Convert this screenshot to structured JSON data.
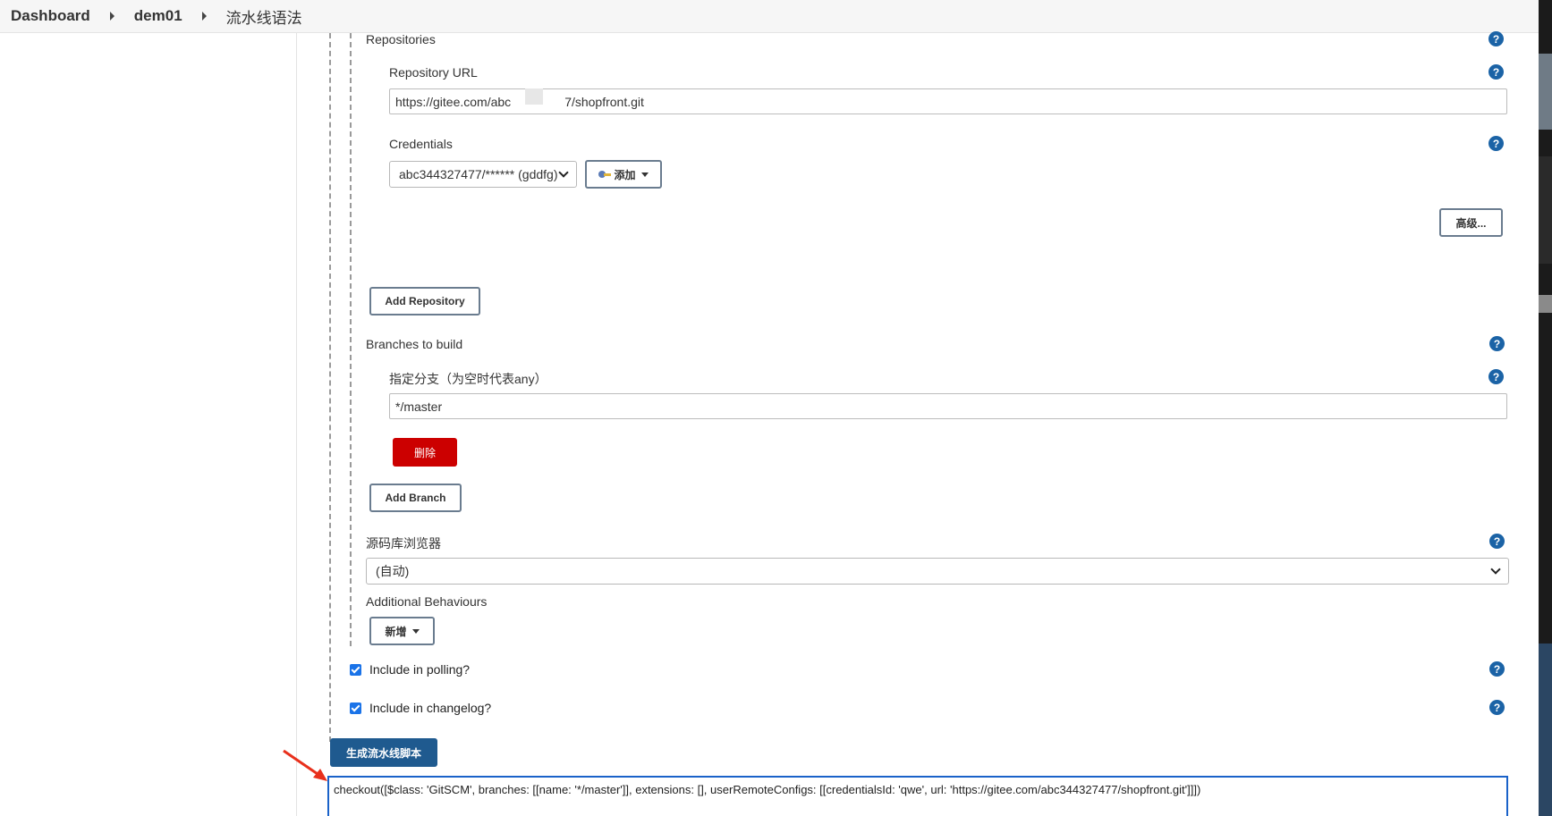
{
  "breadcrumb": {
    "items": [
      "Dashboard",
      "dem01"
    ],
    "current": "流水线语法"
  },
  "form": {
    "repositories_label": "Repositories",
    "repo_url_label": "Repository URL",
    "repo_url_value_prefix": "https://gitee.com/abc",
    "repo_url_value_suffix": "7/shopfront.git",
    "credentials_label": "Credentials",
    "credentials_selected": "abc344327477/****** (gddfg)",
    "add_button": "添加",
    "advanced_button": "高级...",
    "add_repository_button": "Add Repository",
    "branches_label": "Branches to build",
    "branch_spec_label": "指定分支（为空时代表any）",
    "branch_spec_value": "*/master",
    "delete_button": "删除",
    "add_branch_button": "Add Branch",
    "browser_label": "源码库浏览器",
    "browser_selected": "(自动)",
    "additional_label": "Additional Behaviours",
    "new_button": "新增",
    "include_polling_label": "Include in polling?",
    "include_changelog_label": "Include in changelog?",
    "generate_button": "生成流水线脚本",
    "generated_script": "checkout([$class: 'GitSCM', branches: [[name: '*/master']], extensions: [], userRemoteConfigs: [[credentialsId: 'qwe', url: 'https://gitee.com/abc344327477/shopfront.git']]])"
  },
  "icons": {
    "help": "help-icon",
    "key": "key-icon",
    "arrow": "red-arrow-annotation"
  },
  "colors": {
    "help_blue": "#1b63a6",
    "delete_red": "#cc0000",
    "generate_blue": "#1f5a8f",
    "code_border": "#1a62c9",
    "arrow_red": "#e8301c"
  }
}
